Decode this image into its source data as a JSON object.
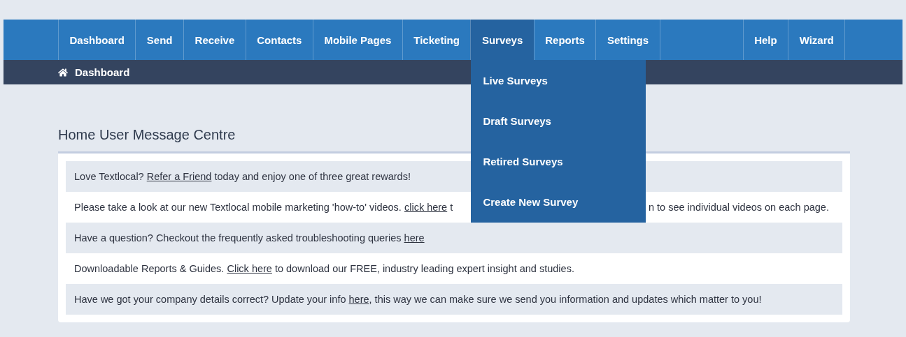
{
  "nav": {
    "items": [
      {
        "label": "Dashboard",
        "selected": false
      },
      {
        "label": "Send",
        "selected": false
      },
      {
        "label": "Receive",
        "selected": false
      },
      {
        "label": "Contacts",
        "selected": false
      },
      {
        "label": "Mobile Pages",
        "selected": false
      },
      {
        "label": "Ticketing",
        "selected": false
      },
      {
        "label": "Surveys",
        "selected": true,
        "menu": [
          "Live Surveys",
          "Draft Surveys",
          "Retired Surveys",
          "Create New Survey"
        ]
      },
      {
        "label": "Reports",
        "selected": false
      },
      {
        "label": "Settings",
        "selected": false
      }
    ],
    "right_items": [
      {
        "label": "Help",
        "selected": false
      },
      {
        "label": "Wizard",
        "selected": false
      }
    ]
  },
  "breadcrumb": {
    "label": "Dashboard"
  },
  "message_centre": {
    "title": "Home User Message Centre",
    "messages": [
      {
        "parts": [
          [
            {
              "text": "Love Textlocal? "
            },
            {
              "text": "Refer a Friend",
              "link": true
            },
            {
              "text": " today and enjoy one of three great rewards!"
            }
          ]
        ]
      },
      {
        "parts": [
          [
            {
              "text": "Please take a look at our new Textlocal mobile marketing 'how-to' videos. "
            },
            {
              "text": "click here",
              "link": true
            },
            {
              "text": " t"
            }
          ],
          [
            {
              "text": "n to see individual videos on each page."
            }
          ]
        ]
      },
      {
        "parts": [
          [
            {
              "text": "Have a question? Checkout the frequently asked troubleshooting queries "
            },
            {
              "text": "here",
              "link": true
            }
          ]
        ]
      },
      {
        "parts": [
          [
            {
              "text": "Downloadable Reports & Guides. "
            },
            {
              "text": "Click here",
              "link": true
            },
            {
              "text": " to download our FREE, industry leading expert insight and studies."
            }
          ]
        ]
      },
      {
        "parts": [
          [
            {
              "text": "Have we got your company details correct? Update your info "
            },
            {
              "text": "here",
              "link": true
            },
            {
              "text": ", this way we can make sure we send you information and updates which matter to you!"
            }
          ]
        ]
      }
    ]
  }
}
